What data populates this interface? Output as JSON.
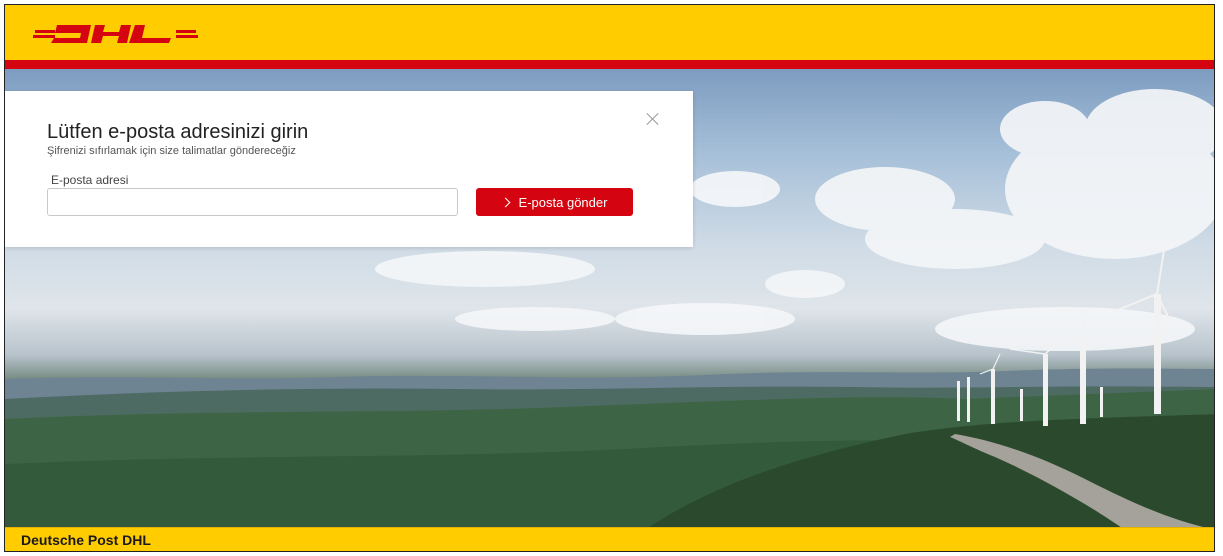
{
  "brand": {
    "logo_text": "DHL",
    "primary_color": "#ffcc00",
    "accent_color": "#d40511"
  },
  "dialog": {
    "title": "Lütfen e-posta adresinizi girin",
    "subtitle": "Şifrenizi sıfırlamak için size talimatlar göndereceğiz",
    "email_label": "E-posta adresi",
    "email_value": "",
    "email_placeholder": "",
    "send_button_label": "E-posta gönder",
    "close_icon": "close-icon"
  },
  "footer": {
    "text": "Deutsche Post DHL"
  }
}
